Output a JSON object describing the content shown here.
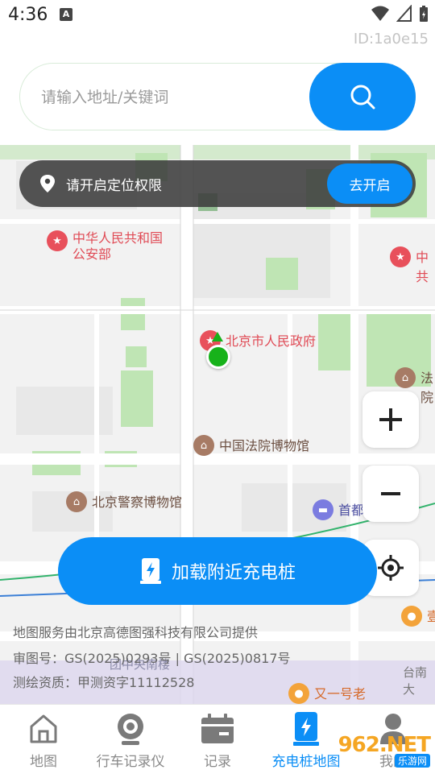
{
  "status_bar": {
    "time": "4:36",
    "notification_badge": "A",
    "icons": [
      "wifi-icon",
      "signal-icon",
      "battery-icon"
    ]
  },
  "id_label": "ID:1a0e15",
  "search": {
    "placeholder": "请输入地址/关键词",
    "value": ""
  },
  "location_banner": {
    "text": "请开启定位权限",
    "button_label": "去开启"
  },
  "map": {
    "pois": [
      {
        "name": "中华人民共和国\n公安部",
        "kind": "red"
      },
      {
        "name": "中共",
        "kind": "red"
      },
      {
        "name": "北京市人民政府",
        "kind": "red"
      },
      {
        "name": "法院",
        "kind": "brown"
      },
      {
        "name": "中国法院博物馆",
        "kind": "brown"
      },
      {
        "name": "北京警察博物馆",
        "kind": "brown"
      },
      {
        "name": "首都",
        "kind": "purple"
      },
      {
        "name": "壹",
        "kind": "orange"
      },
      {
        "name": "又一号老",
        "kind": "orange"
      }
    ],
    "labels": {
      "street": "团中央南楼",
      "area": "台南大"
    },
    "credits": [
      "地图服务由北京高德图强科技有限公司提供",
      "审图号：GS(2025)0293号 | GS(2025)0817号",
      "测绘资质：甲测资字11112528"
    ]
  },
  "controls": {
    "zoom_in": "+",
    "zoom_out": "−",
    "locate": "locate-icon"
  },
  "load_button": {
    "label": "加载附近充电桩"
  },
  "bottom_nav": {
    "items": [
      {
        "label": "地图",
        "icon": "home-icon",
        "active": false
      },
      {
        "label": "行车记录仪",
        "icon": "camera-icon",
        "active": false
      },
      {
        "label": "记录",
        "icon": "record-icon",
        "active": false
      },
      {
        "label": "充电桩地图",
        "icon": "charger-icon",
        "active": true
      },
      {
        "label": "我的",
        "icon": "user-icon",
        "active": false
      }
    ]
  },
  "watermark": {
    "main": "962.NET",
    "sub": "乐游网"
  },
  "colors": {
    "primary": "#0b8ef6",
    "map_bg": "#f1f1f1",
    "park_green": "#bfe5b4",
    "poi_red": "#e8505b"
  }
}
